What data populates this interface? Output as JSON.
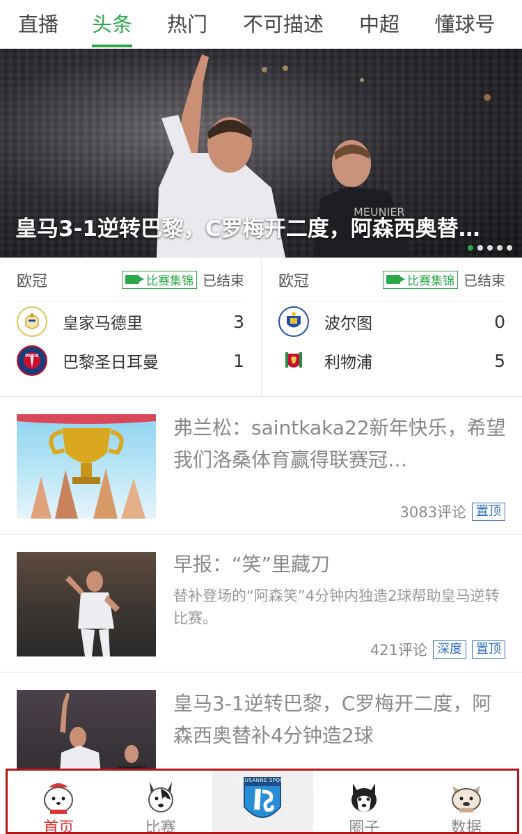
{
  "tabs": [
    {
      "label": "直播"
    },
    {
      "label": "头条",
      "active": true
    },
    {
      "label": "热门"
    },
    {
      "label": "不可描述"
    },
    {
      "label": "中超"
    },
    {
      "label": "懂球号"
    }
  ],
  "hero": {
    "title": "皇马3-1逆转巴黎，C罗梅开二度，阿森西奥替…",
    "dots_total": 5,
    "dots_active_index": 0
  },
  "matches": [
    {
      "league": "欧冠",
      "highlight_label": "比赛集锦",
      "status": "已结束",
      "teams": [
        {
          "name": "皇家马德里",
          "score": "3",
          "badge_icon": "real-madrid-badge-icon"
        },
        {
          "name": "巴黎圣日耳曼",
          "score": "1",
          "badge_icon": "psg-badge-icon"
        }
      ]
    },
    {
      "league": "欧冠",
      "highlight_label": "比赛集锦",
      "status": "已结束",
      "teams": [
        {
          "name": "波尔图",
          "score": "0",
          "badge_icon": "porto-badge-icon"
        },
        {
          "name": "利物浦",
          "score": "5",
          "badge_icon": "liverpool-badge-icon"
        }
      ]
    }
  ],
  "news": [
    {
      "title": "弗兰松：saintkaka22新年快乐，希望我们洛桑体育赢得联赛冠…",
      "comments": "3083评论",
      "tags": [
        "置顶"
      ]
    },
    {
      "title": "早报：“笑”里藏刀",
      "summary": "替补登场的“阿森笑”4分钟内独造2球帮助皇马逆转比赛。",
      "comments": "421评论",
      "tags": [
        "深度",
        "置顶"
      ]
    },
    {
      "title": "皇马3-1逆转巴黎，C罗梅开二度，阿森西奥替补4分钟造2球"
    }
  ],
  "bottom_nav": [
    {
      "label": "首页",
      "icon": "samoyed-dog-icon",
      "active": true
    },
    {
      "label": "比赛",
      "icon": "bull-terrier-dog-icon"
    },
    {
      "label": "",
      "icon": "lausanne-sport-logo-icon",
      "logo_text": "LAUSANNE SPORT"
    },
    {
      "label": "圈子",
      "icon": "husky-dog-icon"
    },
    {
      "label": "数据",
      "icon": "bulldog-icon"
    }
  ],
  "colors": {
    "accent": "#2aa84a",
    "tag_blue": "#2e6fbf",
    "nav_active": "#dd3333",
    "nav_border": "#b01818"
  }
}
